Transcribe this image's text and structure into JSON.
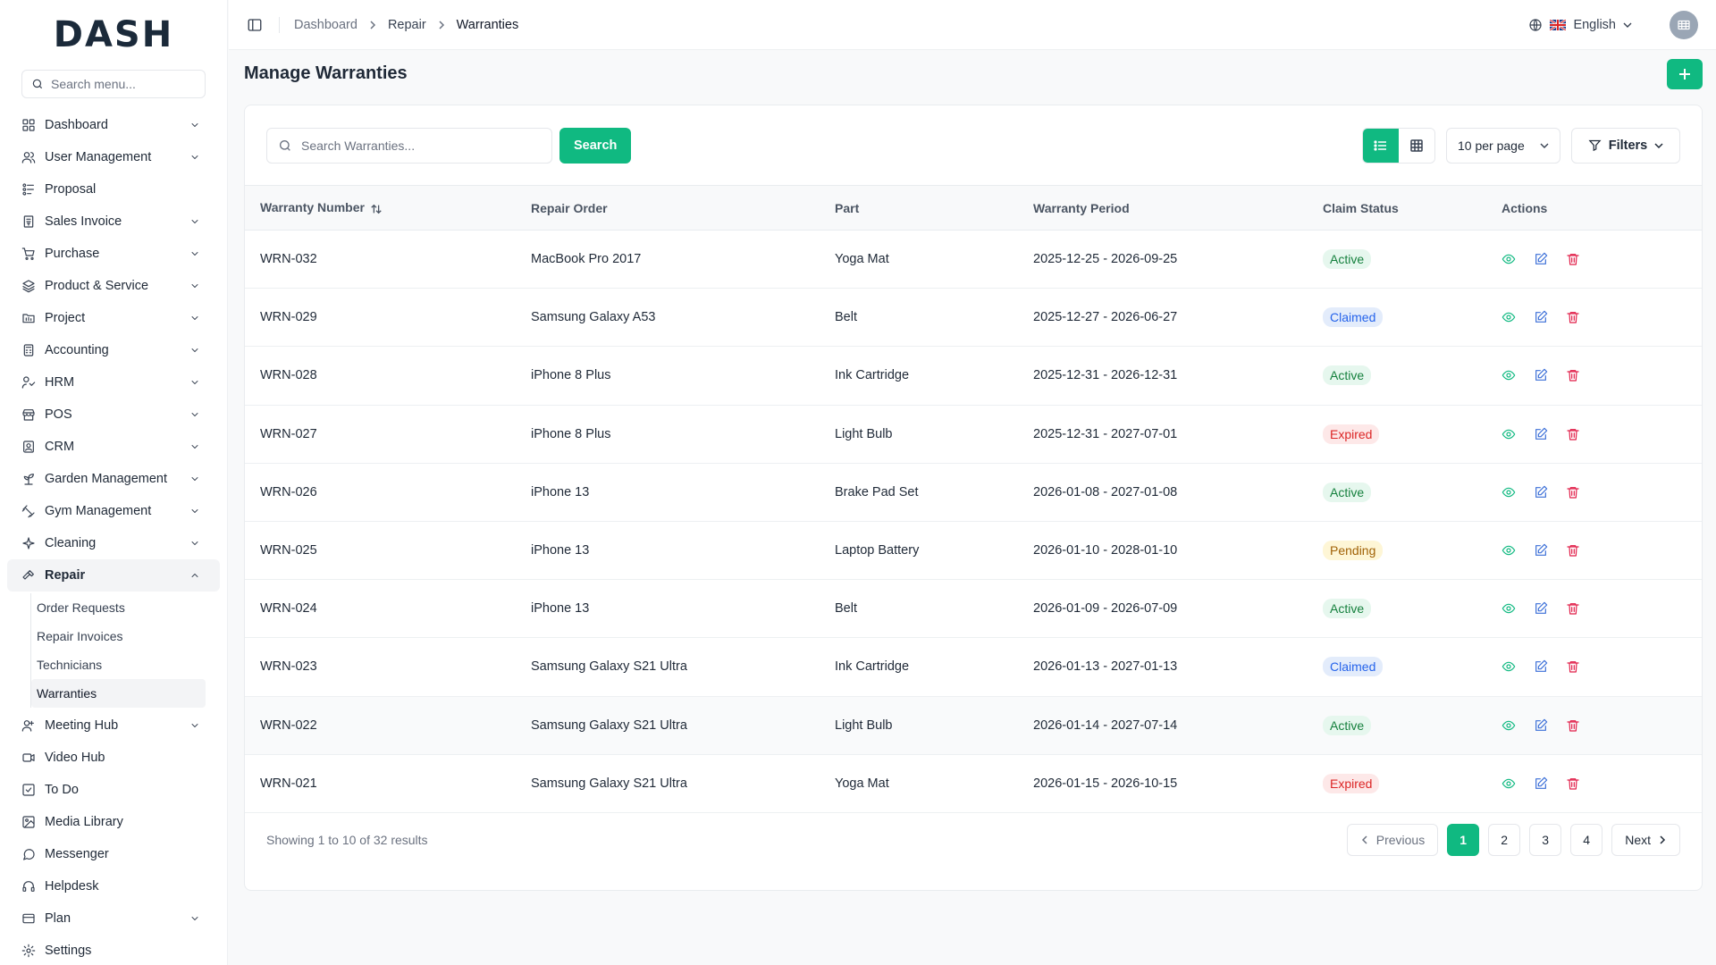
{
  "brand": {
    "logo": "DASH"
  },
  "sidebar": {
    "search_placeholder": "Search menu...",
    "items": [
      {
        "label": "Dashboard",
        "icon": "grid-icon",
        "chevron": true
      },
      {
        "label": "User Management",
        "icon": "users-icon",
        "chevron": true
      },
      {
        "label": "Proposal",
        "icon": "proposal-icon",
        "chevron": false
      },
      {
        "label": "Sales Invoice",
        "icon": "invoice-icon",
        "chevron": true
      },
      {
        "label": "Purchase",
        "icon": "cart-icon",
        "chevron": true
      },
      {
        "label": "Product & Service",
        "icon": "layers-icon",
        "chevron": true
      },
      {
        "label": "Project",
        "icon": "folder-icon",
        "chevron": true
      },
      {
        "label": "Accounting",
        "icon": "calculator-icon",
        "chevron": true
      },
      {
        "label": "HRM",
        "icon": "hrm-icon",
        "chevron": true
      },
      {
        "label": "POS",
        "icon": "store-icon",
        "chevron": true
      },
      {
        "label": "CRM",
        "icon": "contact-icon",
        "chevron": true
      },
      {
        "label": "Garden Management",
        "icon": "plant-icon",
        "chevron": true
      },
      {
        "label": "Gym Management",
        "icon": "dumbbell-icon",
        "chevron": true
      },
      {
        "label": "Cleaning",
        "icon": "sparkle-icon",
        "chevron": true
      },
      {
        "label": "Repair",
        "icon": "hammer-icon",
        "chevron": true,
        "open": true
      }
    ],
    "repair_sub": [
      {
        "label": "Order Requests"
      },
      {
        "label": "Repair Invoices"
      },
      {
        "label": "Technicians"
      },
      {
        "label": "Warranties",
        "active": true
      }
    ],
    "items_after": [
      {
        "label": "Meeting Hub",
        "icon": "meeting-icon",
        "chevron": true
      },
      {
        "label": "Video Hub",
        "icon": "video-icon",
        "chevron": false
      },
      {
        "label": "To Do",
        "icon": "checkbox-icon",
        "chevron": false
      },
      {
        "label": "Media Library",
        "icon": "image-icon",
        "chevron": false
      },
      {
        "label": "Messenger",
        "icon": "chat-icon",
        "chevron": false
      },
      {
        "label": "Helpdesk",
        "icon": "headset-icon",
        "chevron": false
      },
      {
        "label": "Plan",
        "icon": "card-icon",
        "chevron": true
      },
      {
        "label": "Settings",
        "icon": "gear-icon",
        "chevron": false
      }
    ]
  },
  "topbar": {
    "breadcrumb": [
      "Dashboard",
      "Repair",
      "Warranties"
    ],
    "language": "English"
  },
  "page": {
    "title": "Manage Warranties"
  },
  "toolbar": {
    "search_placeholder": "Search Warranties...",
    "search_label": "Search",
    "per_page": "10 per page",
    "filters_label": "Filters"
  },
  "table": {
    "columns": [
      "Warranty Number",
      "Repair Order",
      "Part",
      "Warranty Period",
      "Claim Status",
      "Actions"
    ],
    "rows": [
      {
        "number": "WRN-032",
        "order": "MacBook Pro 2017",
        "part": "Yoga Mat",
        "period": "2025-12-25 - 2026-09-25",
        "status": "Active"
      },
      {
        "number": "WRN-029",
        "order": "Samsung Galaxy A53",
        "part": "Belt",
        "period": "2025-12-27 - 2026-06-27",
        "status": "Claimed"
      },
      {
        "number": "WRN-028",
        "order": "iPhone 8 Plus",
        "part": "Ink Cartridge",
        "period": "2025-12-31 - 2026-12-31",
        "status": "Active"
      },
      {
        "number": "WRN-027",
        "order": "iPhone 8 Plus",
        "part": "Light Bulb",
        "period": "2025-12-31 - 2027-07-01",
        "status": "Expired"
      },
      {
        "number": "WRN-026",
        "order": "iPhone 13",
        "part": "Brake Pad Set",
        "period": "2026-01-08 - 2027-01-08",
        "status": "Active"
      },
      {
        "number": "WRN-025",
        "order": "iPhone 13",
        "part": "Laptop Battery",
        "period": "2026-01-10 - 2028-01-10",
        "status": "Pending"
      },
      {
        "number": "WRN-024",
        "order": "iPhone 13",
        "part": "Belt",
        "period": "2026-01-09 - 2026-07-09",
        "status": "Active"
      },
      {
        "number": "WRN-023",
        "order": "Samsung Galaxy S21 Ultra",
        "part": "Ink Cartridge",
        "period": "2026-01-13 - 2027-01-13",
        "status": "Claimed"
      },
      {
        "number": "WRN-022",
        "order": "Samsung Galaxy S21 Ultra",
        "part": "Light Bulb",
        "period": "2026-01-14 - 2027-07-14",
        "status": "Active"
      },
      {
        "number": "WRN-021",
        "order": "Samsung Galaxy S21 Ultra",
        "part": "Yoga Mat",
        "period": "2026-01-15 - 2026-10-15",
        "status": "Expired"
      }
    ]
  },
  "footer": {
    "showing": "Showing 1 to 10 of 32 results",
    "previous": "Previous",
    "next": "Next",
    "pages": [
      "1",
      "2",
      "3",
      "4"
    ],
    "current_page": "1"
  },
  "colors": {
    "accent": "#10b981",
    "edit": "#3b6fd8",
    "delete": "#e11d48"
  }
}
